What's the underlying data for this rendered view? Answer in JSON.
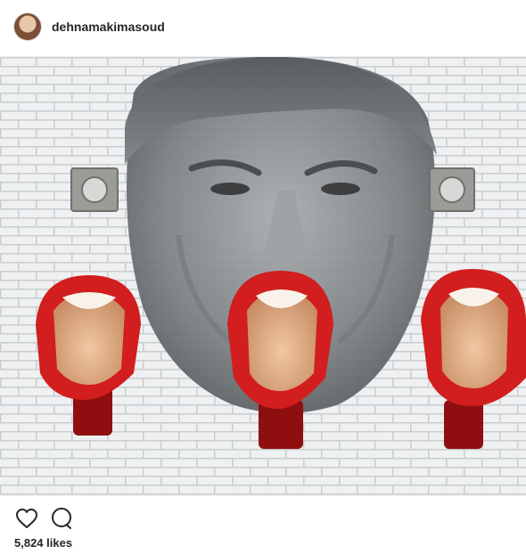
{
  "post": {
    "author": {
      "username": "dehnamakimasoud"
    },
    "image": {
      "description_icon": "photo",
      "colors": {
        "tile": "#eef0f1",
        "grout": "#c9cdcf",
        "lips": "#d21e1e",
        "lips_dark": "#8f0f10",
        "inner": "#e8b78e",
        "face": "#8c8f91",
        "hair": "#5a5d60"
      }
    },
    "actions": {
      "like_icon": "heart-icon",
      "comment_icon": "comment-icon"
    },
    "likes": {
      "label": "5,824 likes"
    }
  }
}
